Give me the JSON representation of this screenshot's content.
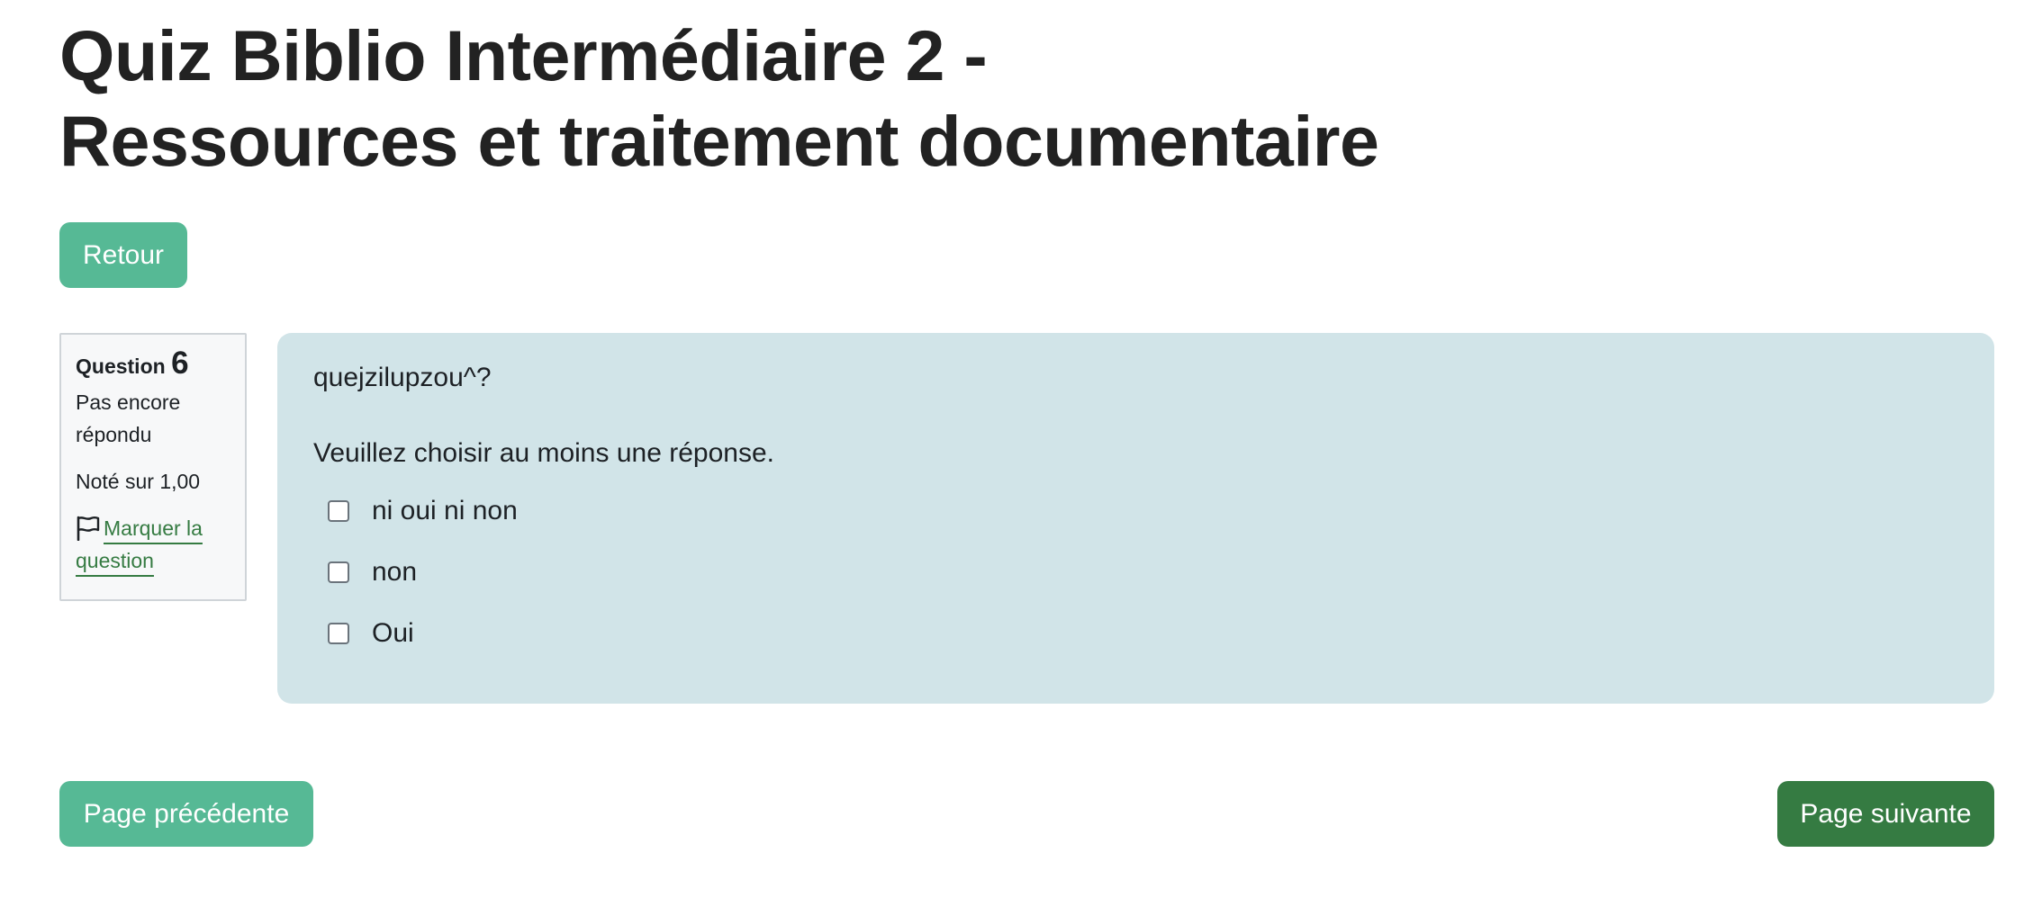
{
  "page": {
    "title_line1": "Quiz Biblio Intermédiaire 2 -",
    "title_line2": "Ressources et traitement documentaire"
  },
  "nav": {
    "back_label": "Retour",
    "prev_label": "Page précédente",
    "next_label": "Page suivante"
  },
  "question_info": {
    "label": "Question",
    "number": "6",
    "state": "Pas encore répondu",
    "grade": "Noté sur 1,00",
    "flag_label": "Marquer la question",
    "flag_icon": "flag-icon"
  },
  "question": {
    "text": "quejzilupzou^?",
    "prompt": "Veuillez choisir au moins une réponse.",
    "answers": [
      {
        "label": "ni oui ni non",
        "checked": false
      },
      {
        "label": "non",
        "checked": false
      },
      {
        "label": "Oui",
        "checked": false
      }
    ]
  },
  "colors": {
    "primary_light": "#56b995",
    "primary_dark": "#357b42",
    "content_bg": "#d1e4e8",
    "info_bg": "#f7f8f9"
  }
}
